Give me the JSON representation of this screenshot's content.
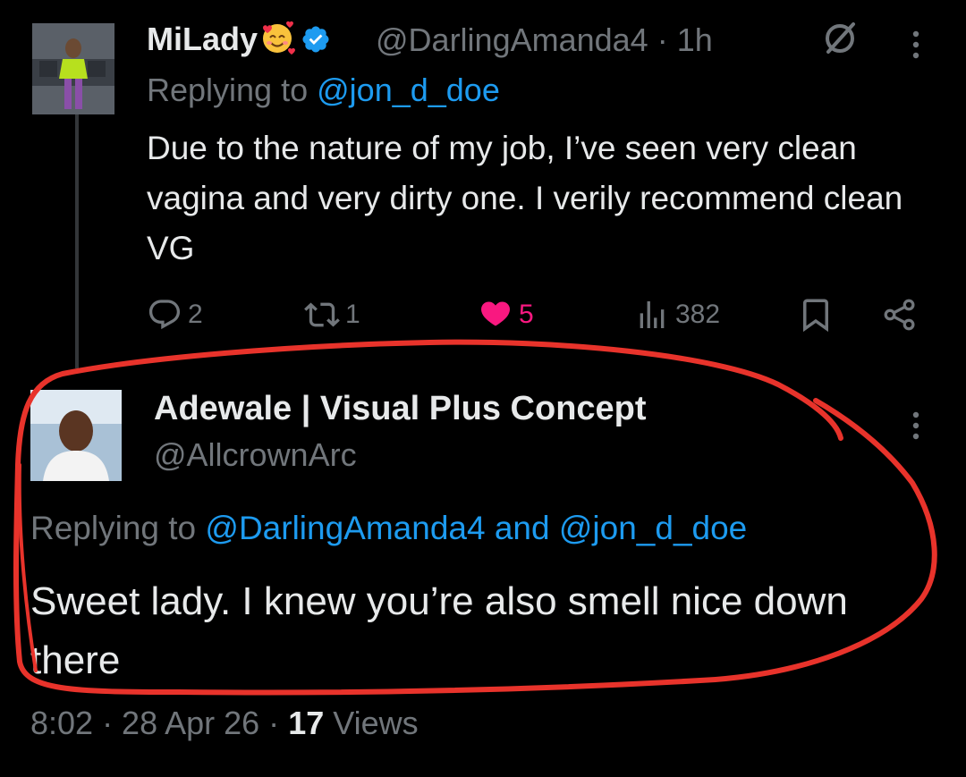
{
  "parent_tweet": {
    "display_name": "MiLady",
    "emoji": "smiling-face-with-hearts",
    "verified_icon": "verified-badge-icon",
    "handle_time": "@DarlingAmanda4 · 1h",
    "replying_prefix": "Replying to",
    "replying_to": "@jon_d_doe",
    "text": "Due to the nature of my job, I’ve seen very clean vagina and very dirty one. I verily recommend clean VG",
    "actions": {
      "replies": "2",
      "reposts": "1",
      "likes": "5",
      "views": "382"
    }
  },
  "reply_tweet": {
    "display_name": "Adewale | Visual Plus Concept",
    "handle": "@AllcrownArc",
    "replying_prefix": "Replying to",
    "replying_to_1": "@DarlingAmanda4",
    "replying_and": "and",
    "replying_to_2": "@jon_d_doe",
    "text": "Sweet lady. I knew you’re also smell nice down there",
    "timestamp": "8:02 · 28 Apr 26 ·",
    "views_count": "17",
    "views_label": "Views"
  },
  "colors": {
    "background": "#000000",
    "text": "#e7e9ea",
    "muted": "#71767b",
    "link": "#1d9bf0",
    "like": "#f91880",
    "annotation": "#e8332b"
  }
}
